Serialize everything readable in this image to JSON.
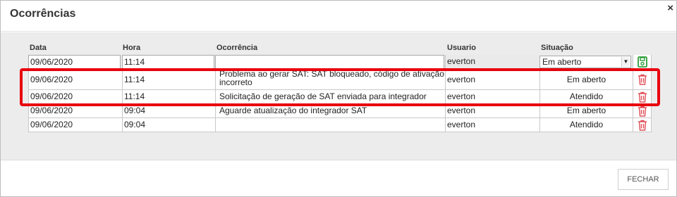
{
  "modal": {
    "title": "Ocorrências",
    "close_label": "×"
  },
  "table": {
    "headers": {
      "data": "Data",
      "hora": "Hora",
      "ocorrencia": "Ocorrência",
      "usuario": "Usuario",
      "situacao": "Situação"
    },
    "new_row": {
      "data": "09/06/2020",
      "hora": "11:14",
      "ocorrencia": "",
      "usuario": "everton",
      "situacao": "Em aberto"
    },
    "rows": [
      {
        "data": "09/06/2020",
        "hora": "11:14",
        "ocorrencia": "Problema ao gerar SAT: SAT bloqueado, código de ativação incorreto",
        "usuario": "everton",
        "situacao": "Em aberto"
      },
      {
        "data": "09/06/2020",
        "hora": "11:14",
        "ocorrencia": "Solicitação de geração de SAT enviada para integrador",
        "usuario": "everton",
        "situacao": "Atendido"
      },
      {
        "data": "09/06/2020",
        "hora": "09:04",
        "ocorrencia": "Aguarde atualização do integrador SAT",
        "usuario": "everton",
        "situacao": "Em aberto"
      },
      {
        "data": "09/06/2020",
        "hora": "09:04",
        "ocorrencia": "",
        "usuario": "everton",
        "situacao": "Atendido"
      }
    ]
  },
  "footer": {
    "close_button_label": "FECHAR"
  },
  "icons": {
    "save": "save-icon",
    "delete": "trash-icon"
  },
  "colors": {
    "highlight": "#e8000d",
    "save_icon": "#2e9e3a",
    "delete_icon": "#e0505a"
  }
}
